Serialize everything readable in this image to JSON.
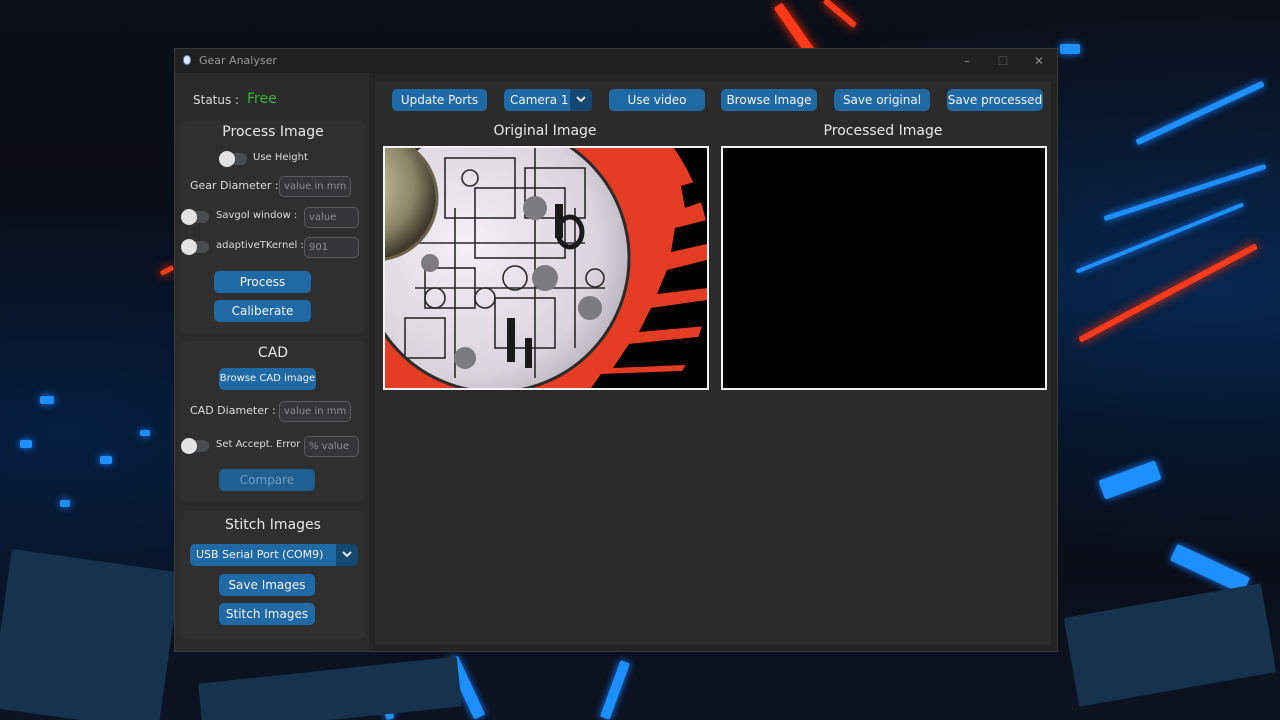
{
  "window": {
    "title": "Gear Analyser",
    "controls": {
      "minimize": "–",
      "maximize": "☐",
      "close": "✕"
    }
  },
  "status": {
    "label": "Status :",
    "value": "Free",
    "value_color": "#2fb52f"
  },
  "process_image": {
    "heading": "Process Image",
    "use_height_label": "Use Height",
    "gear_diameter_label": "Gear Diameter :",
    "gear_diameter_placeholder": "value in mm",
    "savgol_label": "Savgol window :",
    "savgol_placeholder": "value",
    "adaptive_label": "adaptiveTKernel :",
    "adaptive_placeholder": "901",
    "process_button": "Process",
    "calibrate_button": "Caliberate"
  },
  "cad": {
    "heading": "CAD",
    "browse_button": "Browse CAD image",
    "cad_diameter_label": "CAD Diameter :",
    "cad_diameter_placeholder": "value in mm",
    "accept_error_label": "Set Accept. Error :",
    "accept_error_placeholder": "% value",
    "compare_button": "Compare"
  },
  "stitch": {
    "heading": "Stitch Images",
    "port_selected": "USB Serial Port (COM9)",
    "save_button": "Save Images",
    "stitch_button": "Stitch Images"
  },
  "toolbar": {
    "update_ports": "Update Ports",
    "camera_selected": "Camera 1",
    "use_video": "Use video",
    "browse_image": "Browse Image",
    "save_original": "Save original",
    "save_processed": "Save processed"
  },
  "panels": {
    "original_title": "Original Image",
    "processed_title": "Processed Image"
  },
  "colors": {
    "accent": "#1f6aa5",
    "window_bg": "#242424",
    "frame_bg": "#2b2b2b"
  },
  "icons": {
    "dropdown": "chevron-down-icon",
    "app": "app-icon"
  }
}
